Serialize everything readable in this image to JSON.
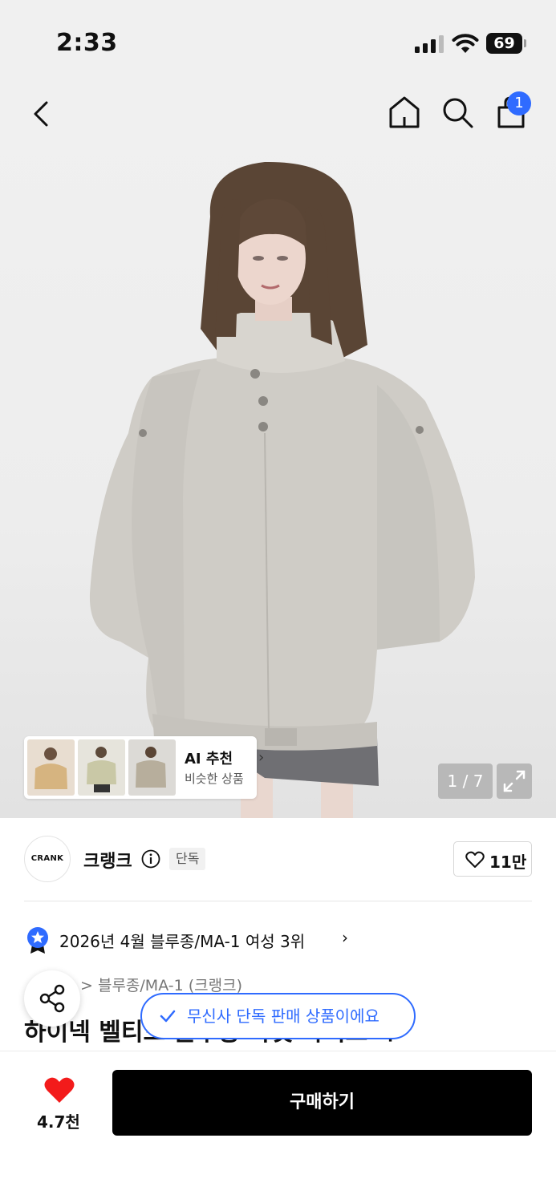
{
  "status_bar": {
    "time": "2:33",
    "battery": "69"
  },
  "nav": {
    "cart_count": "1"
  },
  "hero": {
    "ai_card": {
      "title": "AI 추천",
      "subtitle": "비슷한 상품"
    },
    "image_counter": "1 / 7"
  },
  "brand": {
    "logo_text": "CRANK",
    "name": "크랭크",
    "exclusive_tag": "단독",
    "like_count": "11만"
  },
  "ranking": {
    "text": "2026년 4월 블루종/MA-1 여성 3위"
  },
  "category": {
    "text": "> 블루종/MA-1 (크랭크)"
  },
  "product": {
    "title": "하이넥 벨티드 블루종 자켓 라이트 베이지"
  },
  "toast": {
    "text": "무신사 단독 판매 상품이에요"
  },
  "bottom": {
    "like_count": "4.7천",
    "buy_label": "구매하기"
  },
  "colors": {
    "accent": "#2f6bff",
    "heart": "#f31b1b",
    "buy_bg": "#000000"
  },
  "icons": [
    "back-icon",
    "home-icon",
    "search-icon",
    "cart-icon",
    "expand-icon",
    "info-icon",
    "heart-icon",
    "ranking-badge-icon",
    "share-icon",
    "check-icon"
  ]
}
